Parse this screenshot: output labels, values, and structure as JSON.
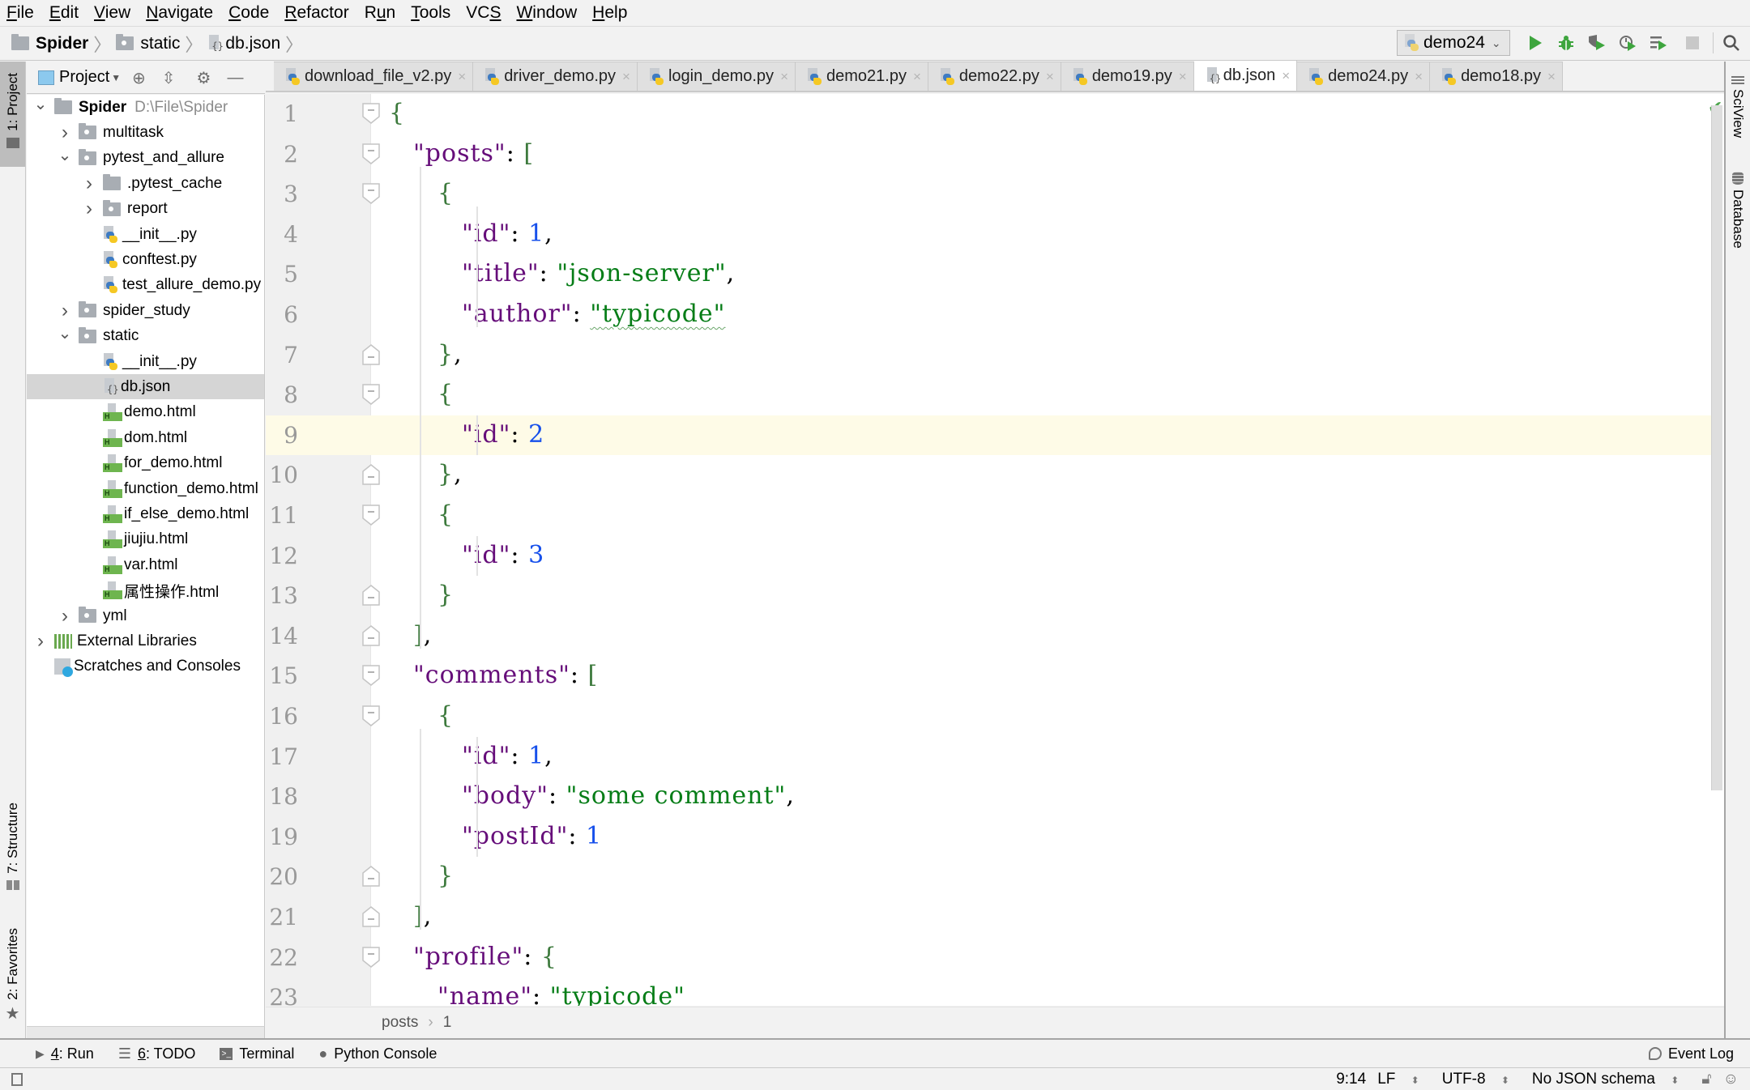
{
  "menu": [
    {
      "label": "File",
      "mnemonic": "F",
      "rest": "ile"
    },
    {
      "label": "Edit",
      "mnemonic": "E",
      "rest": "dit"
    },
    {
      "label": "View",
      "mnemonic": "V",
      "rest": "iew"
    },
    {
      "label": "Navigate",
      "mnemonic": "N",
      "rest": "avigate"
    },
    {
      "label": "Code",
      "mnemonic": "C",
      "rest": "ode"
    },
    {
      "label": "Refactor",
      "mnemonic": "R",
      "rest": "efactor"
    },
    {
      "label": "Run",
      "pre": "R",
      "mnemonic": "u",
      "rest": "n"
    },
    {
      "label": "Tools",
      "mnemonic": "T",
      "rest": "ools"
    },
    {
      "label": "VCS",
      "pre": "VC",
      "mnemonic": "S",
      "rest": ""
    },
    {
      "label": "Window",
      "mnemonic": "W",
      "rest": "indow"
    },
    {
      "label": "Help",
      "mnemonic": "H",
      "rest": "elp"
    }
  ],
  "breadcrumb": [
    "Spider",
    "static",
    "db.json"
  ],
  "run_config": "demo24",
  "toolbar_icons": [
    "run-icon",
    "debug-icon",
    "coverage-icon",
    "profile-icon",
    "concurrency-icon",
    "stop-icon",
    "search-icon"
  ],
  "left_strip": {
    "project": "1: Project",
    "structure": "7: Structure",
    "favorites": "2: Favorites"
  },
  "right_strip": {
    "sciview": "SciView",
    "database": "Database"
  },
  "project_panel": {
    "title": "Project",
    "tree": [
      {
        "label": "Spider",
        "path": "D:\\File\\Spider",
        "depth": 0,
        "arrow": "down",
        "icon": "folder",
        "bold": true
      },
      {
        "label": "multitask",
        "depth": 1,
        "arrow": "right",
        "icon": "package"
      },
      {
        "label": "pytest_and_allure",
        "depth": 1,
        "arrow": "down",
        "icon": "package"
      },
      {
        "label": ".pytest_cache",
        "depth": 2,
        "arrow": "right",
        "icon": "folder"
      },
      {
        "label": "report",
        "depth": 2,
        "arrow": "right",
        "icon": "package"
      },
      {
        "label": "__init__.py",
        "depth": 2,
        "icon": "python"
      },
      {
        "label": "conftest.py",
        "depth": 2,
        "icon": "python"
      },
      {
        "label": "test_allure_demo.py",
        "depth": 2,
        "icon": "python"
      },
      {
        "label": "spider_study",
        "depth": 1,
        "arrow": "right",
        "icon": "package"
      },
      {
        "label": "static",
        "depth": 1,
        "arrow": "down",
        "icon": "package"
      },
      {
        "label": "__init__.py",
        "depth": 2,
        "icon": "python"
      },
      {
        "label": "db.json",
        "depth": 2,
        "icon": "json",
        "selected": true
      },
      {
        "label": "demo.html",
        "depth": 2,
        "icon": "html"
      },
      {
        "label": "dom.html",
        "depth": 2,
        "icon": "html"
      },
      {
        "label": "for_demo.html",
        "depth": 2,
        "icon": "html"
      },
      {
        "label": "function_demo.html",
        "depth": 2,
        "icon": "html"
      },
      {
        "label": "if_else_demo.html",
        "depth": 2,
        "icon": "html"
      },
      {
        "label": "jiujiu.html",
        "depth": 2,
        "icon": "html"
      },
      {
        "label": "var.html",
        "depth": 2,
        "icon": "html"
      },
      {
        "label": "属性操作.html",
        "depth": 2,
        "icon": "html"
      },
      {
        "label": "yml",
        "depth": 1,
        "arrow": "right",
        "icon": "package"
      },
      {
        "label": "External Libraries",
        "depth": 0,
        "arrow": "right",
        "icon": "libraries"
      },
      {
        "label": "Scratches and Consoles",
        "depth": 0,
        "icon": "scratches"
      }
    ]
  },
  "tabs": [
    {
      "label": "download_file_v2.py",
      "icon": "python"
    },
    {
      "label": "driver_demo.py",
      "icon": "python"
    },
    {
      "label": "login_demo.py",
      "icon": "python"
    },
    {
      "label": "demo21.py",
      "icon": "python"
    },
    {
      "label": "demo22.py",
      "icon": "python"
    },
    {
      "label": "demo19.py",
      "icon": "python"
    },
    {
      "label": "db.json",
      "icon": "json",
      "active": true
    },
    {
      "label": "demo24.py",
      "icon": "python"
    },
    {
      "label": "demo18.py",
      "icon": "python"
    }
  ],
  "editor": {
    "current_line": 9,
    "lines": [
      {
        "n": "1",
        "indent": 0,
        "fold": "open",
        "tokens": [
          [
            "br",
            "{"
          ]
        ]
      },
      {
        "n": "2",
        "indent": 1,
        "fold": "open",
        "tokens": [
          [
            "k",
            "\"posts\""
          ],
          [
            "p",
            ": "
          ],
          [
            "br",
            "["
          ]
        ]
      },
      {
        "n": "3",
        "indent": 2,
        "fold": "open",
        "tokens": [
          [
            "br",
            "{"
          ]
        ]
      },
      {
        "n": "4",
        "indent": 3,
        "tokens": [
          [
            "k",
            "\"id\""
          ],
          [
            "p",
            ": "
          ],
          [
            "n",
            "1"
          ],
          [
            "p",
            ","
          ]
        ]
      },
      {
        "n": "5",
        "indent": 3,
        "tokens": [
          [
            "k",
            "\"title\""
          ],
          [
            "p",
            ": "
          ],
          [
            "s",
            "\"json-server\""
          ],
          [
            "p",
            ","
          ]
        ]
      },
      {
        "n": "6",
        "indent": 3,
        "tokens": [
          [
            "k",
            "\"author\""
          ],
          [
            "p",
            ": "
          ],
          [
            "s",
            "\"typicode\"",
            "squiggle"
          ]
        ]
      },
      {
        "n": "7",
        "indent": 2,
        "fold": "close",
        "tokens": [
          [
            "br",
            "}"
          ],
          [
            "p",
            ","
          ]
        ]
      },
      {
        "n": "8",
        "indent": 2,
        "fold": "open",
        "tokens": [
          [
            "br",
            "{"
          ]
        ]
      },
      {
        "n": "9",
        "indent": 3,
        "tokens": [
          [
            "k",
            "\"id\""
          ],
          [
            "p",
            ": "
          ],
          [
            "n",
            "2"
          ]
        ]
      },
      {
        "n": "10",
        "indent": 2,
        "fold": "close",
        "tokens": [
          [
            "br",
            "}"
          ],
          [
            "p",
            ","
          ]
        ]
      },
      {
        "n": "11",
        "indent": 2,
        "fold": "open",
        "tokens": [
          [
            "br",
            "{"
          ]
        ]
      },
      {
        "n": "12",
        "indent": 3,
        "tokens": [
          [
            "k",
            "\"id\""
          ],
          [
            "p",
            ": "
          ],
          [
            "n",
            "3"
          ]
        ]
      },
      {
        "n": "13",
        "indent": 2,
        "fold": "close",
        "tokens": [
          [
            "br",
            "}"
          ]
        ]
      },
      {
        "n": "14",
        "indent": 1,
        "fold": "close",
        "tokens": [
          [
            "br",
            "]"
          ],
          [
            "p",
            ","
          ]
        ]
      },
      {
        "n": "15",
        "indent": 1,
        "fold": "open",
        "tokens": [
          [
            "k",
            "\"comments\""
          ],
          [
            "p",
            ": "
          ],
          [
            "br",
            "["
          ]
        ]
      },
      {
        "n": "16",
        "indent": 2,
        "fold": "open",
        "tokens": [
          [
            "br",
            "{"
          ]
        ]
      },
      {
        "n": "17",
        "indent": 3,
        "tokens": [
          [
            "k",
            "\"id\""
          ],
          [
            "p",
            ": "
          ],
          [
            "n",
            "1"
          ],
          [
            "p",
            ","
          ]
        ]
      },
      {
        "n": "18",
        "indent": 3,
        "tokens": [
          [
            "k",
            "\"body\""
          ],
          [
            "p",
            ": "
          ],
          [
            "s",
            "\"some comment\""
          ],
          [
            "p",
            ","
          ]
        ]
      },
      {
        "n": "19",
        "indent": 3,
        "tokens": [
          [
            "k",
            "\"postId\""
          ],
          [
            "p",
            ": "
          ],
          [
            "n",
            "1"
          ]
        ]
      },
      {
        "n": "20",
        "indent": 2,
        "fold": "close",
        "tokens": [
          [
            "br",
            "}"
          ]
        ]
      },
      {
        "n": "21",
        "indent": 1,
        "fold": "close",
        "tokens": [
          [
            "br",
            "]"
          ],
          [
            "p",
            ","
          ]
        ]
      },
      {
        "n": "22",
        "indent": 1,
        "fold": "open",
        "tokens": [
          [
            "k",
            "\"profile\""
          ],
          [
            "p",
            ": "
          ],
          [
            "br",
            "{"
          ]
        ]
      },
      {
        "n": "23",
        "indent": 2,
        "tokens": [
          [
            "k",
            "\"name\""
          ],
          [
            "p",
            ": "
          ],
          [
            "s",
            "\"typicode\""
          ]
        ]
      }
    ]
  },
  "editor_breadcrumb": [
    "posts",
    "1"
  ],
  "bottom_tools": [
    {
      "label": "4: Run",
      "icon": "run-icon"
    },
    {
      "label": "6: TODO",
      "icon": "todo-icon"
    },
    {
      "label": "Terminal",
      "icon": "terminal-icon"
    },
    {
      "label": "Python Console",
      "icon": "python-console-icon"
    }
  ],
  "event_log": "Event Log",
  "status": {
    "position": "9:14",
    "line_sep": "LF",
    "encoding": "UTF-8",
    "schema": "No JSON schema"
  },
  "colors": {
    "key": "#660e7a",
    "string": "#067d17",
    "number": "#1750eb",
    "current_line": "#fefbe7",
    "run_green": "#3ea53e"
  }
}
